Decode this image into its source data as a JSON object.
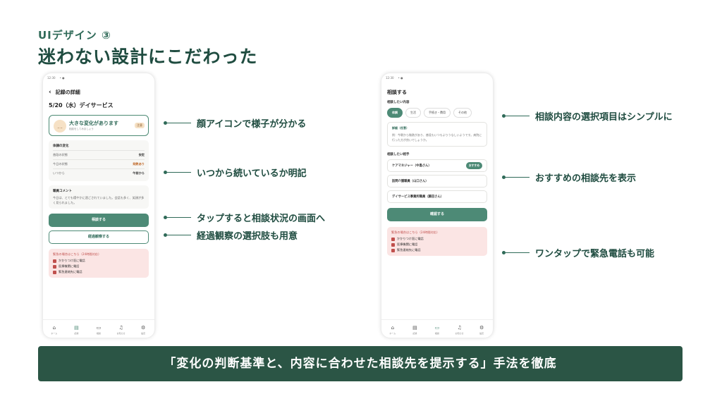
{
  "slide": {
    "subtitle": "UIデザイン ③",
    "title": "迷わない設計にこだわった",
    "banner": "「変化の判断基準と、内容に合わせた相談先を提示する」手法を徹底"
  },
  "phone_left": {
    "status_time": "12:30",
    "header": "記録の詳細",
    "date_line": "5/20（水）デイサービス",
    "state_card": {
      "face": "_ _",
      "title": "大きな変化があります",
      "sub": "相談をしてみましょう",
      "badge": "注意"
    },
    "body_box": {
      "title": "体調の変化",
      "rows": [
        {
          "label": "普段の状態",
          "value": "安定"
        },
        {
          "label": "今日の状態",
          "value": "発熱あり"
        },
        {
          "label": "いつから",
          "value": "午前から"
        }
      ]
    },
    "comment_box": {
      "title": "職員コメント",
      "text": "今日は、とても穏やかに過ごされていました。会話も多く、笑顔が多く見られました。"
    },
    "consult_button": "相談する",
    "observe_button": "経過観察する",
    "emergency": {
      "title": "緊急の場合はこちら（24時間対応）",
      "items": [
        "かかりつけ医に電話",
        "医療機関に電話",
        "緊急連絡先に電話"
      ]
    },
    "nav": [
      {
        "icon": "⌂",
        "label": "ホーム"
      },
      {
        "icon": "▤",
        "label": "記録"
      },
      {
        "icon": "▭",
        "label": "相談"
      },
      {
        "icon": "♫",
        "label": "お知らせ"
      },
      {
        "icon": "⚙",
        "label": "設定"
      }
    ]
  },
  "phone_right": {
    "status_time": "12:30",
    "header": "相談する",
    "content_label": "相談したい内容",
    "chips": [
      "体調",
      "生活",
      "手続き・費用",
      "その他"
    ],
    "detail": {
      "label": "詳細（任意）",
      "text": "例：今朝から微熱があり、普段もいつもよりうなしいようです。病院に行った方が良いでしょうか。"
    },
    "partner_label": "相談したい相手",
    "contacts": [
      {
        "name": "ケアマネジャー（中島さん）",
        "badge": "おすすめ"
      },
      {
        "name": "訪問介護職員（山口さん）",
        "badge": ""
      },
      {
        "name": "デイサービス事業所職員（藤田さん）",
        "badge": ""
      }
    ],
    "confirm_button": "確認する",
    "emergency": {
      "title": "緊急の場合はこちら（24時間対応）",
      "items": [
        "かかりつけ医に電話",
        "医療機関に電話",
        "緊急連絡先に電話"
      ]
    },
    "nav": [
      {
        "icon": "⌂",
        "label": "ホーム"
      },
      {
        "icon": "▤",
        "label": "記録"
      },
      {
        "icon": "▭",
        "label": "相談"
      },
      {
        "icon": "♫",
        "label": "お知らせ"
      },
      {
        "icon": "⚙",
        "label": "設定"
      }
    ]
  },
  "callouts_left": [
    "顔アイコンで様子が分かる",
    "いつから続いているか明記",
    "タップすると相談状況の画面へ",
    "経過観察の選択肢も用意"
  ],
  "callouts_right": [
    "相談内容の選択項目はシンプルに",
    "おすすめの相談先を表示",
    "ワンタップで緊急電話も可能"
  ],
  "colors": {
    "accent": "#4d8a76",
    "dark": "#2b5545",
    "emergency_bg": "#fbe5e4"
  }
}
